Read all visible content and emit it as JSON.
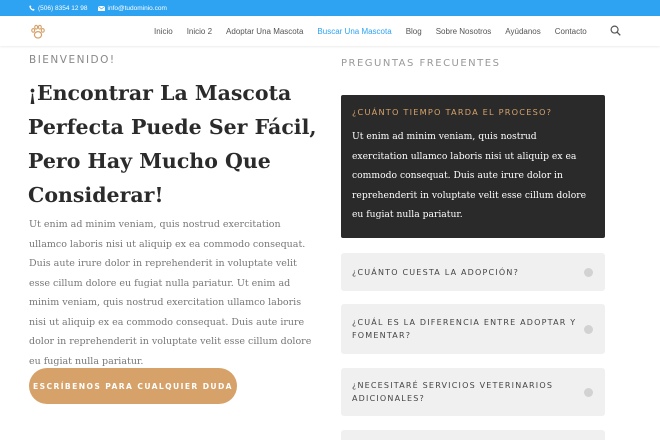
{
  "topbar": {
    "phone": "(506) 8354 12 98",
    "email": "info@tudominio.com",
    "phone_icon": "phone-icon",
    "email_icon": "envelope-icon",
    "background": "#2ea3f2"
  },
  "header": {
    "logo_icon": "paw-icon",
    "nav": [
      {
        "label": "Inicio",
        "active": false
      },
      {
        "label": "Inicio 2",
        "active": false
      },
      {
        "label": "Adoptar Una Mascota",
        "active": false
      },
      {
        "label": "Buscar Una Mascota",
        "active": true
      },
      {
        "label": "Blog",
        "active": false
      },
      {
        "label": "Sobre Nosotros",
        "active": false
      },
      {
        "label": "Ayúdanos",
        "active": false
      },
      {
        "label": "Contacto",
        "active": false
      }
    ],
    "search_icon": "search-icon",
    "active_color": "#2ea3f2"
  },
  "hero": {
    "eyebrow": "BIENVENIDO!",
    "title": "¡Encontrar La Mascota Perfecta Puede Ser Fácil, Pero Hay Mucho Que Considerar!",
    "body": "Ut enim ad minim veniam, quis nostrud exercitation ullamco laboris nisi ut aliquip ex ea commodo consequat. Duis aute irure dolor in reprehenderit in voluptate velit esse cillum dolore eu fugiat nulla pariatur. Ut enim ad minim veniam, quis nostrud exercitation ullamco laboris nisi ut aliquip ex ea commodo consequat. Duis aute irure dolor in reprehenderit in voluptate velit esse cillum dolore eu fugiat nulla pariatur.",
    "cta_label": "ESCRÍBENOS PARA CUALQUIER DUDA",
    "cta_color": "#d6a26a"
  },
  "faq": {
    "title": "PREGUNTAS FRECUENTES",
    "open_item": {
      "question": "¿CUÁNTO TIEMPO TARDA EL PROCESO?",
      "answer": "Ut enim ad minim veniam, quis nostrud exercitation ullamco laboris nisi ut aliquip ex ea commodo consequat. Duis aute irure dolor in reprehenderit in voluptate velit esse cillum dolore eu fugiat nulla pariatur."
    },
    "items": [
      {
        "question": "¿CUÁNTO CUESTA LA ADOPCIÓN?"
      },
      {
        "question": "¿CUÁL ES LA DIFERENCIA ENTRE ADOPTAR Y FOMENTAR?"
      },
      {
        "question": "¿NECESITARÉ SERVICIOS VETERINARIOS ADICIONALES?"
      },
      {
        "question": ""
      }
    ],
    "open_background": "#2a2a2a",
    "accent": "#d6a26a"
  }
}
